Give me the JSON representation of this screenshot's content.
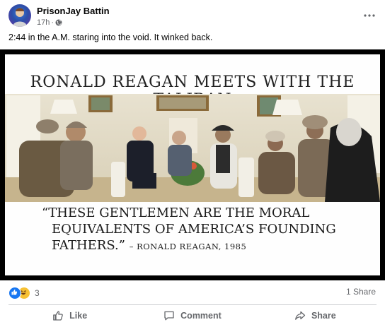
{
  "post": {
    "author": "PrisonJay Battin",
    "timestamp": "17h",
    "separator": "·",
    "audience_icon": "globe-icon",
    "caption": "2:44 in the A.M. staring into the void. It winked back.",
    "more_icon": "more-horizontal-icon"
  },
  "image": {
    "headline": "RONALD REAGAN MEETS WITH THE TALIBAN",
    "quote_line1": "“THESE GENTLEMEN ARE THE MORAL",
    "quote_line2": "EQUIVALENTS OF AMERICA’S FOUNDING",
    "quote_line3": "FATHERS.”",
    "attribution": "– RONALD REAGAN, 1985"
  },
  "stats": {
    "reaction_icons": [
      "like-reaction-icon",
      "haha-reaction-icon"
    ],
    "reaction_count": "3",
    "share_count": "1 Share"
  },
  "actions": {
    "like": "Like",
    "comment": "Comment",
    "share": "Share"
  },
  "colors": {
    "like_blue": "#1877f2",
    "haha_yellow": "#f7c133",
    "secondary_text": "#65676b",
    "divider": "#ced0d4"
  }
}
